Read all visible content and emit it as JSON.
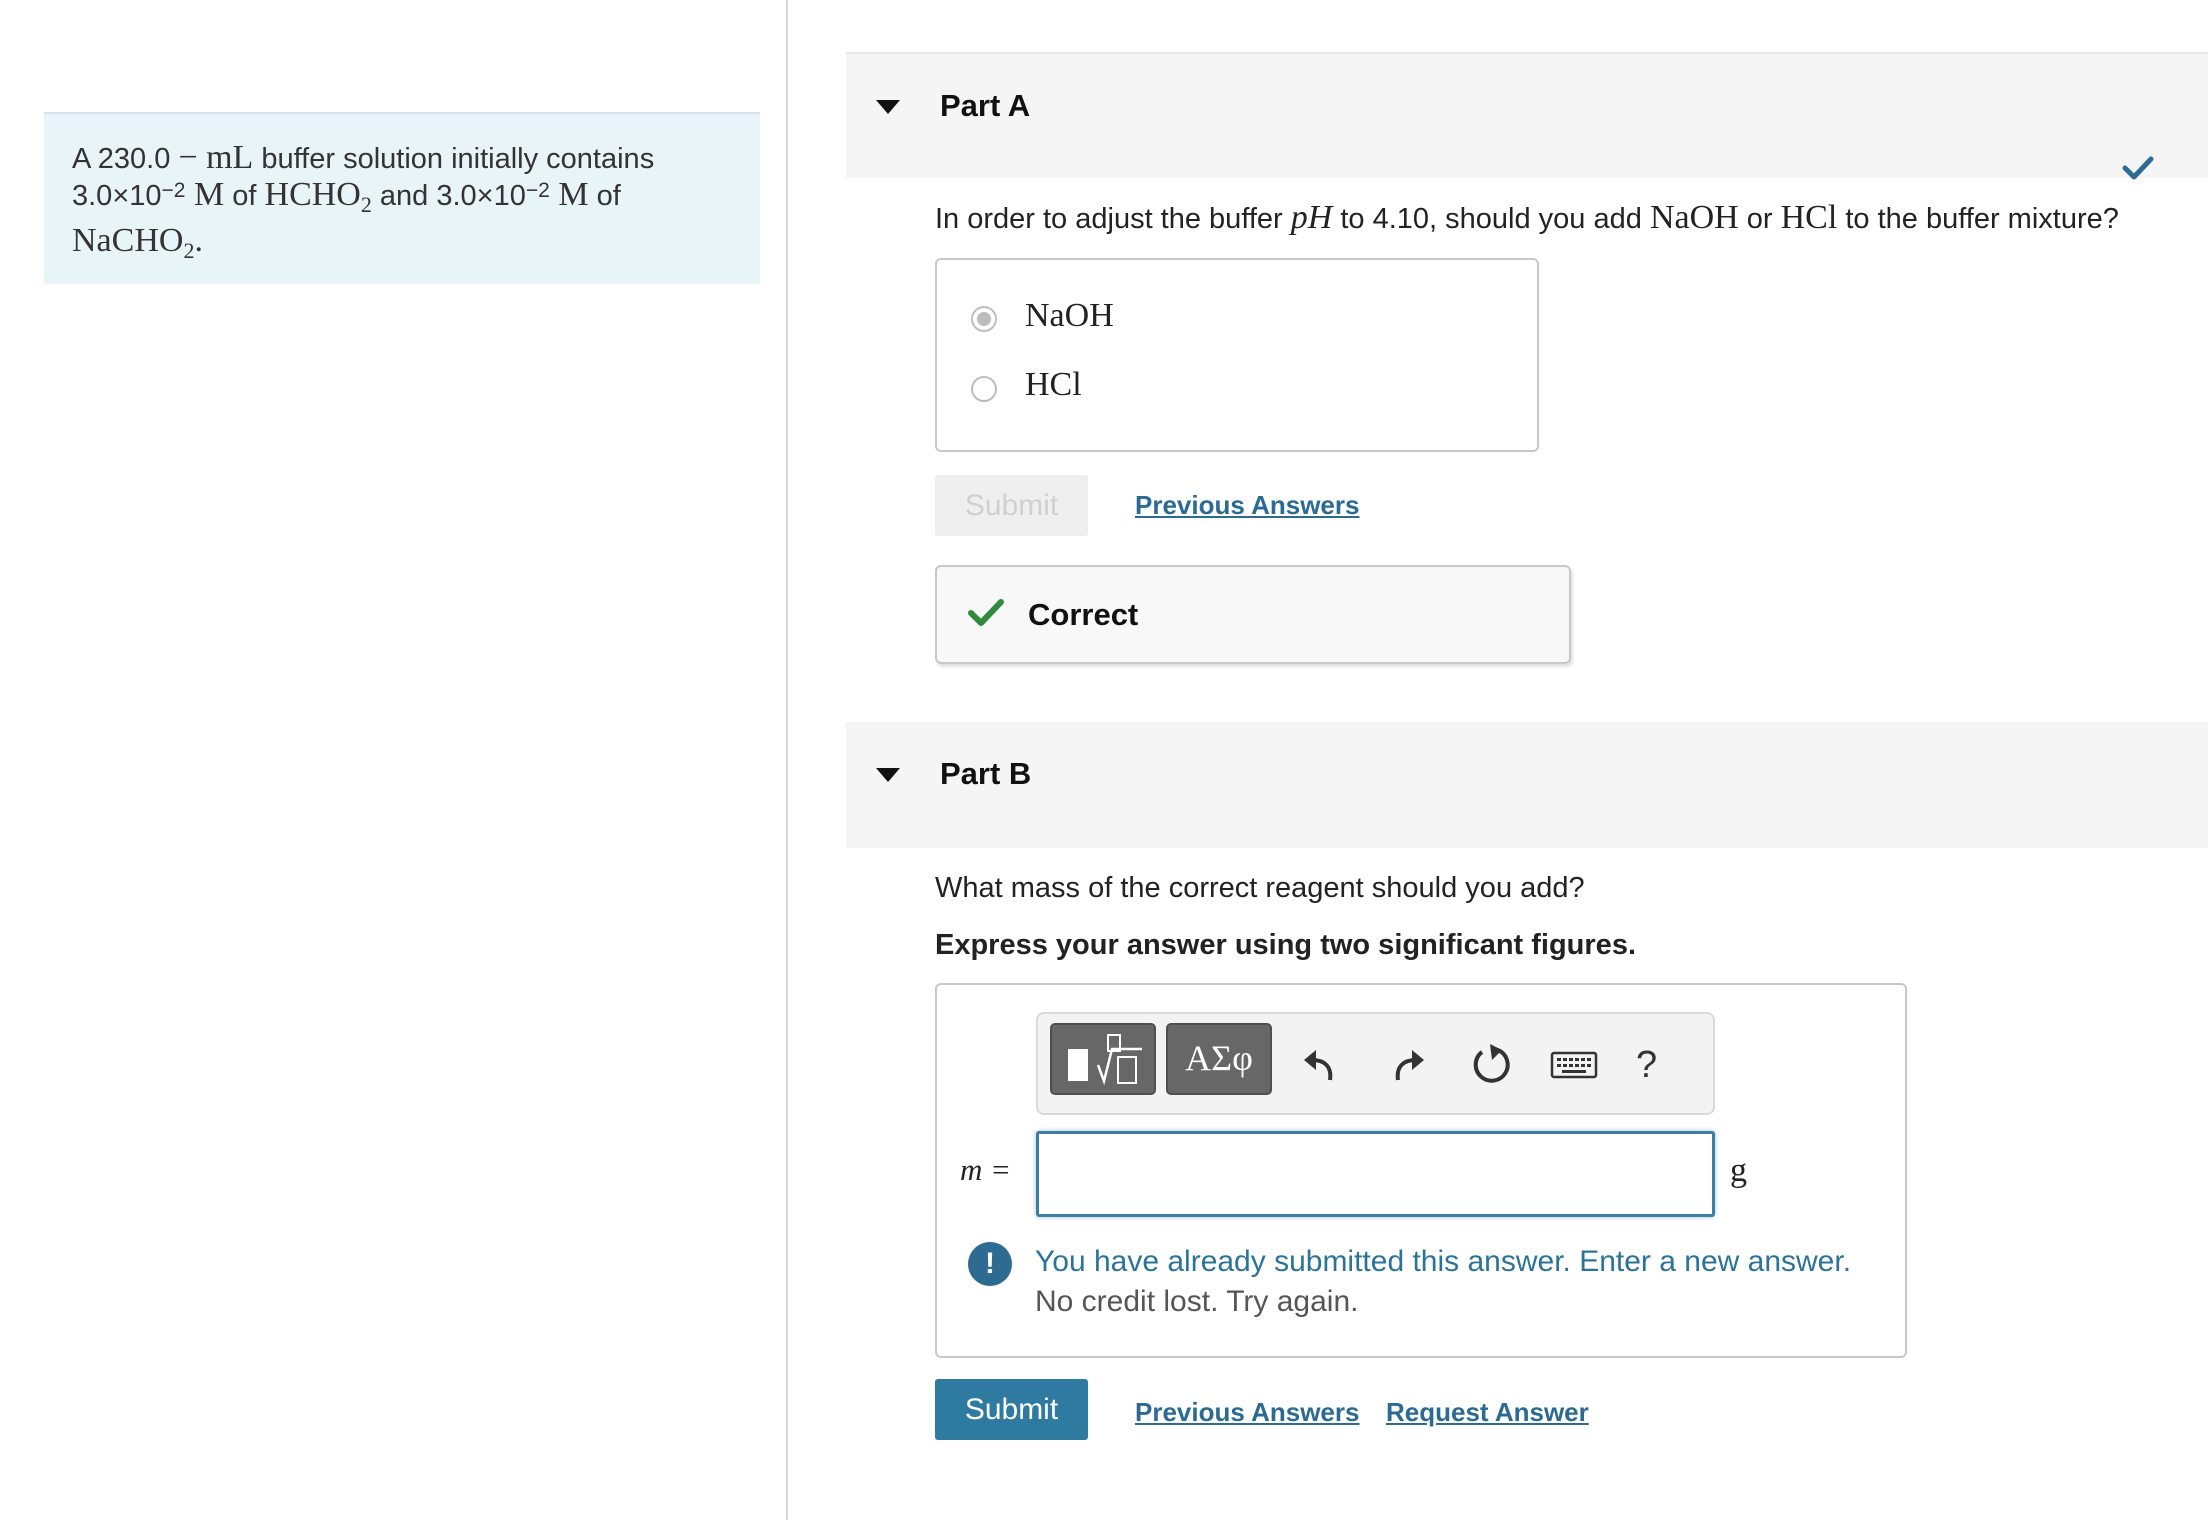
{
  "problem": {
    "prefix": "A 230.0",
    "unit_ml": "− mL",
    "text1": " buffer solution initially contains",
    "conc1": "3.0×10",
    "exp1": "−2",
    "unit_M1": " M",
    "of1": " of ",
    "acid": "HCHO",
    "acid_sub": "2",
    "and": " and 3.0×10",
    "exp2": "−2",
    "unit_M2": " M",
    "of2": " of",
    "salt": "NaCHO",
    "salt_sub": "2",
    "period": "."
  },
  "partA": {
    "title": "Part A",
    "question_start": "In order to adjust the buffer ",
    "question_ph": "pH",
    "question_mid": " to 4.10, should you add ",
    "question_naoh": "NaOH",
    "question_or": " or ",
    "question_hcl": "HCl",
    "question_end": " to the buffer mixture?",
    "options": [
      "NaOH",
      "HCl"
    ],
    "selected": "NaOH",
    "submit_label": "Submit",
    "previous_answers": "Previous Answers",
    "feedback": "Correct"
  },
  "partB": {
    "title": "Part B",
    "question": "What mass of the correct reagent should you add?",
    "instruction": "Express your answer using two significant figures.",
    "toolbar": {
      "greek_label": "ΑΣφ",
      "help_label": "?"
    },
    "variable_label": "m =",
    "unit": "g",
    "answer_value": "",
    "warning_line1": "You have already submitted this answer. Enter a new answer.",
    "warning_line2": "No credit lost. Try again.",
    "submit_label": "Submit",
    "previous_answers": "Previous Answers",
    "request_answer": "Request Answer"
  },
  "colors": {
    "accent": "#2e7aa0",
    "link": "#2b6a93",
    "correct_green": "#2f8a3a",
    "intro_bg": "#e8f4f7"
  }
}
